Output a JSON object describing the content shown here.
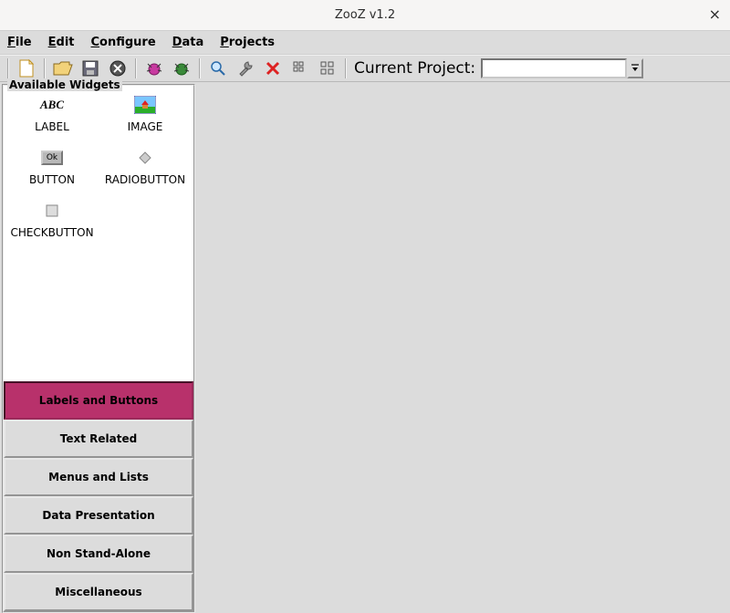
{
  "window": {
    "title": "ZooZ v1.2"
  },
  "menu": {
    "items": [
      {
        "label": "File",
        "ukey": "F"
      },
      {
        "label": "Edit",
        "ukey": "E"
      },
      {
        "label": "Configure",
        "ukey": "C"
      },
      {
        "label": "Data",
        "ukey": "D"
      },
      {
        "label": "Projects",
        "ukey": "P"
      }
    ]
  },
  "toolbar": {
    "project_label": "Current Project:",
    "project_value": "",
    "buttons": {
      "new": "new-file-icon",
      "open": "open-folder-icon",
      "save": "save-icon",
      "close": "close-circle-icon",
      "bug1": "bug-pink-icon",
      "bug2": "bug-green-icon",
      "zoom": "magnifier-icon",
      "wrench": "wrench-icon",
      "delete": "red-x-icon",
      "grid1": "grid-small-icon",
      "grid2": "grid-large-icon"
    }
  },
  "sidebar": {
    "title": "Available Widgets",
    "categories": [
      {
        "label": "Labels and Buttons",
        "active": true
      },
      {
        "label": "Text Related",
        "active": false
      },
      {
        "label": "Menus and Lists",
        "active": false
      },
      {
        "label": "Data Presentation",
        "active": false
      },
      {
        "label": "Non Stand-Alone",
        "active": false
      },
      {
        "label": "Miscellaneous",
        "active": false
      }
    ],
    "widgets": [
      {
        "label": "LABEL",
        "icon": "abc-icon"
      },
      {
        "label": "IMAGE",
        "icon": "house-image-icon"
      },
      {
        "label": "BUTTON",
        "icon": "ok-button-icon"
      },
      {
        "label": "RADIOBUTTON",
        "icon": "diamond-icon"
      },
      {
        "label": "CHECKBUTTON",
        "icon": "checkbox-icon"
      }
    ]
  }
}
